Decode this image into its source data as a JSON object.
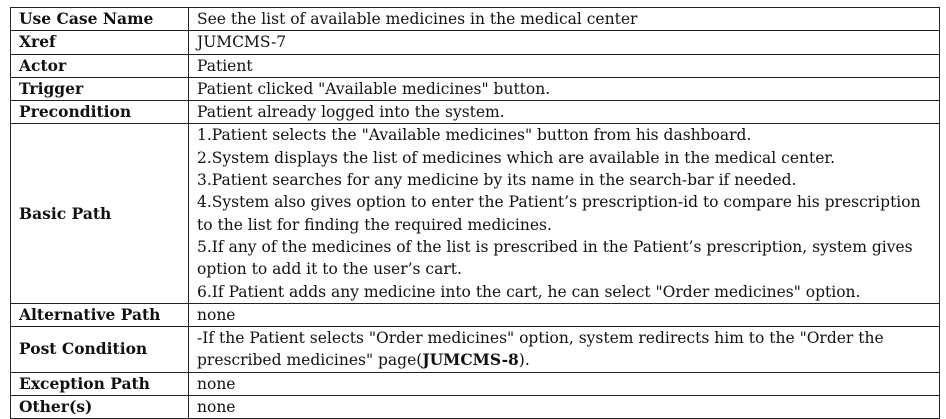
{
  "rows": {
    "use_case_name": {
      "label": "Use Case Name",
      "value": "See the list of available medicines in the medical center"
    },
    "xref": {
      "label": "Xref",
      "value": "JUMCMS-7"
    },
    "actor": {
      "label": "Actor",
      "value": "Patient"
    },
    "trigger": {
      "label": "Trigger",
      "value": "Patient clicked \"Available medicines\" button."
    },
    "precondition": {
      "label": "Precondition",
      "value": "Patient already logged into the system."
    },
    "basic_path": {
      "label": "Basic Path",
      "steps": [
        "1.Patient selects the \"Available medicines\" button from his dashboard.",
        "2.System displays the list of medicines which are available in the medical center.",
        "3.Patient searches for any medicine by its name in the search-bar if needed.",
        "4.System also gives option to enter the Patient’s prescription-id to compare his prescription to the list for finding the required medicines.",
        "5.If any of the medicines of the list is prescribed in the Patient’s prescription, system gives option to add it to the user’s cart.",
        "6.If Patient adds any medicine into the cart, he can select \"Order medicines\" option."
      ]
    },
    "alternative_path": {
      "label": "Alternative Path",
      "value": "none"
    },
    "post_condition": {
      "label": "Post Condition",
      "value_prefix": "-If the Patient selects \"Order medicines\" option, system redirects him to the \"Order the prescribed medicines\" page(",
      "value_ref": "JUMCMS-8",
      "value_suffix": ")."
    },
    "exception_path": {
      "label": "Exception Path",
      "value": "none"
    },
    "others": {
      "label": "Other(s)",
      "value": "none"
    }
  }
}
